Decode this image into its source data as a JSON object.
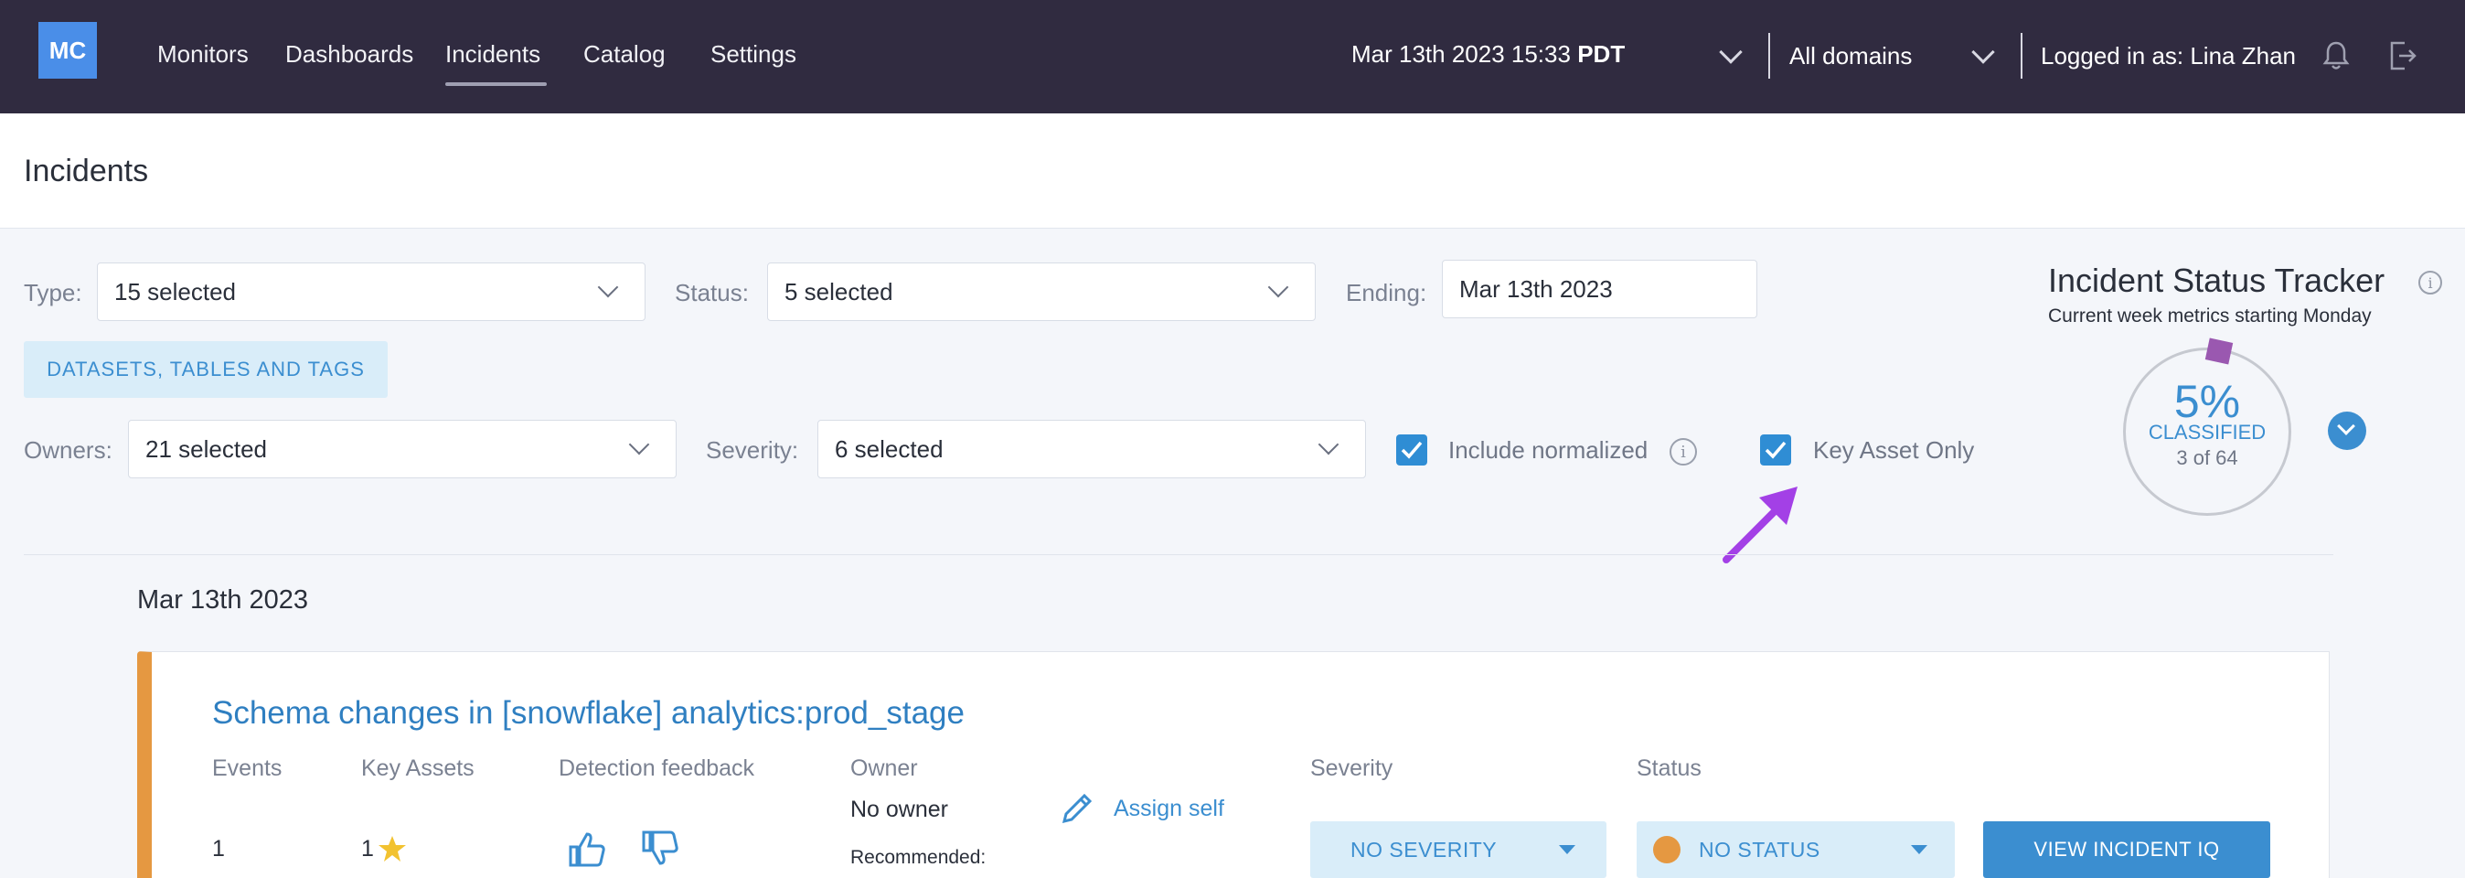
{
  "nav": {
    "logo": "MC",
    "items": [
      "Monitors",
      "Dashboards",
      "Incidents",
      "Catalog",
      "Settings"
    ],
    "active": "Incidents",
    "date_main": "Mar 13th 2023 15:33",
    "date_tz": "PDT",
    "domains": "All domains",
    "logged_in": "Logged in as: Lina Zhan"
  },
  "page": {
    "title": "Incidents"
  },
  "filters": {
    "type_label": "Type:",
    "type_value": "15 selected",
    "status_label": "Status:",
    "status_value": "5 selected",
    "ending_label": "Ending:",
    "ending_value": "Mar 13th 2023",
    "datasets_button": "DATASETS, TABLES AND TAGS",
    "owners_label": "Owners:",
    "owners_value": "21 selected",
    "severity_label": "Severity:",
    "severity_value": "6 selected",
    "include_normalized": "Include normalized",
    "key_asset_only": "Key Asset Only"
  },
  "tracker": {
    "title": "Incident Status Tracker",
    "subtitle": "Current week metrics starting Monday",
    "percent": "5%",
    "classified": "CLASSIFIED",
    "count": "3 of 64"
  },
  "incidents": {
    "date": "Mar 13th 2023",
    "item": {
      "title": "Schema changes in [snowflake] analytics:prod_stage",
      "col_events": "Events",
      "col_key_assets": "Key Assets",
      "col_detection": "Detection feedback",
      "col_owner": "Owner",
      "col_severity": "Severity",
      "col_status": "Status",
      "events": "1",
      "key_assets": "1",
      "owner": "No owner",
      "recommended": "Recommended:",
      "assign_self": "Assign self",
      "severity_value": "NO SEVERITY",
      "status_value": "NO STATUS",
      "view_button": "VIEW INCIDENT IQ"
    }
  },
  "colors": {
    "nav_bg": "#302b40",
    "accent": "#3b8ed0",
    "incident_stripe": "#e59841",
    "annotation_arrow": "#a340e6",
    "tracker_tick": "#9a58b0"
  }
}
